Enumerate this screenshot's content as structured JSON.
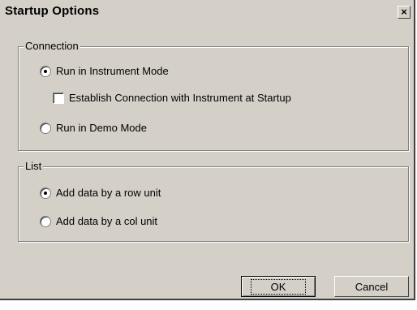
{
  "window": {
    "title": "Startup Options",
    "close_label": "×"
  },
  "connection": {
    "legend": "Connection",
    "run_instrument": "Run in Instrument Mode",
    "establish_connection": "Establish Connection with Instrument at Startup",
    "run_demo": "Run in Demo Mode",
    "selected": "run_instrument",
    "establish_checked": false
  },
  "list": {
    "legend": "List",
    "row_unit": "Add data by a row unit",
    "col_unit": "Add data by a col unit",
    "selected": "row_unit"
  },
  "buttons": {
    "ok": "OK",
    "cancel": "Cancel"
  }
}
